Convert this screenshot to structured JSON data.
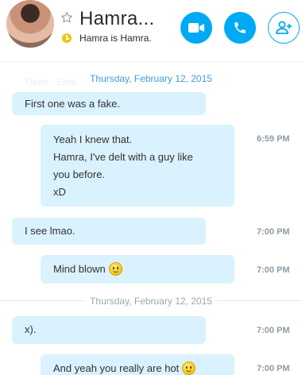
{
  "header": {
    "title": "Hamra...",
    "status": "Hamra is Hamra."
  },
  "chat": {
    "date_top": "Thursday, February 12, 2015",
    "date_mid": "Thursday, February 12, 2015",
    "messages": [
      {
        "lines": [
          "First one was a fake."
        ],
        "time": ""
      },
      {
        "lines": [
          "Yeah I knew that.",
          "Hamra, I've delt with a guy like",
          "you before.",
          "xD"
        ],
        "time": "6:59 PM"
      },
      {
        "lines": [
          "I see lmao."
        ],
        "time": "7:00 PM"
      },
      {
        "lines": [
          "Mind blown"
        ],
        "time": "7:00 PM"
      },
      {
        "lines": [
          "x)."
        ],
        "time": "7:00 PM"
      },
      {
        "lines": [
          "And yeah you really are hot"
        ],
        "time": "7:00 PM"
      }
    ]
  },
  "colors": {
    "accent": "#00a9f4",
    "bubble": "#d9f2fd",
    "date_text": "#3c9fd6",
    "status": "#f3c316"
  }
}
